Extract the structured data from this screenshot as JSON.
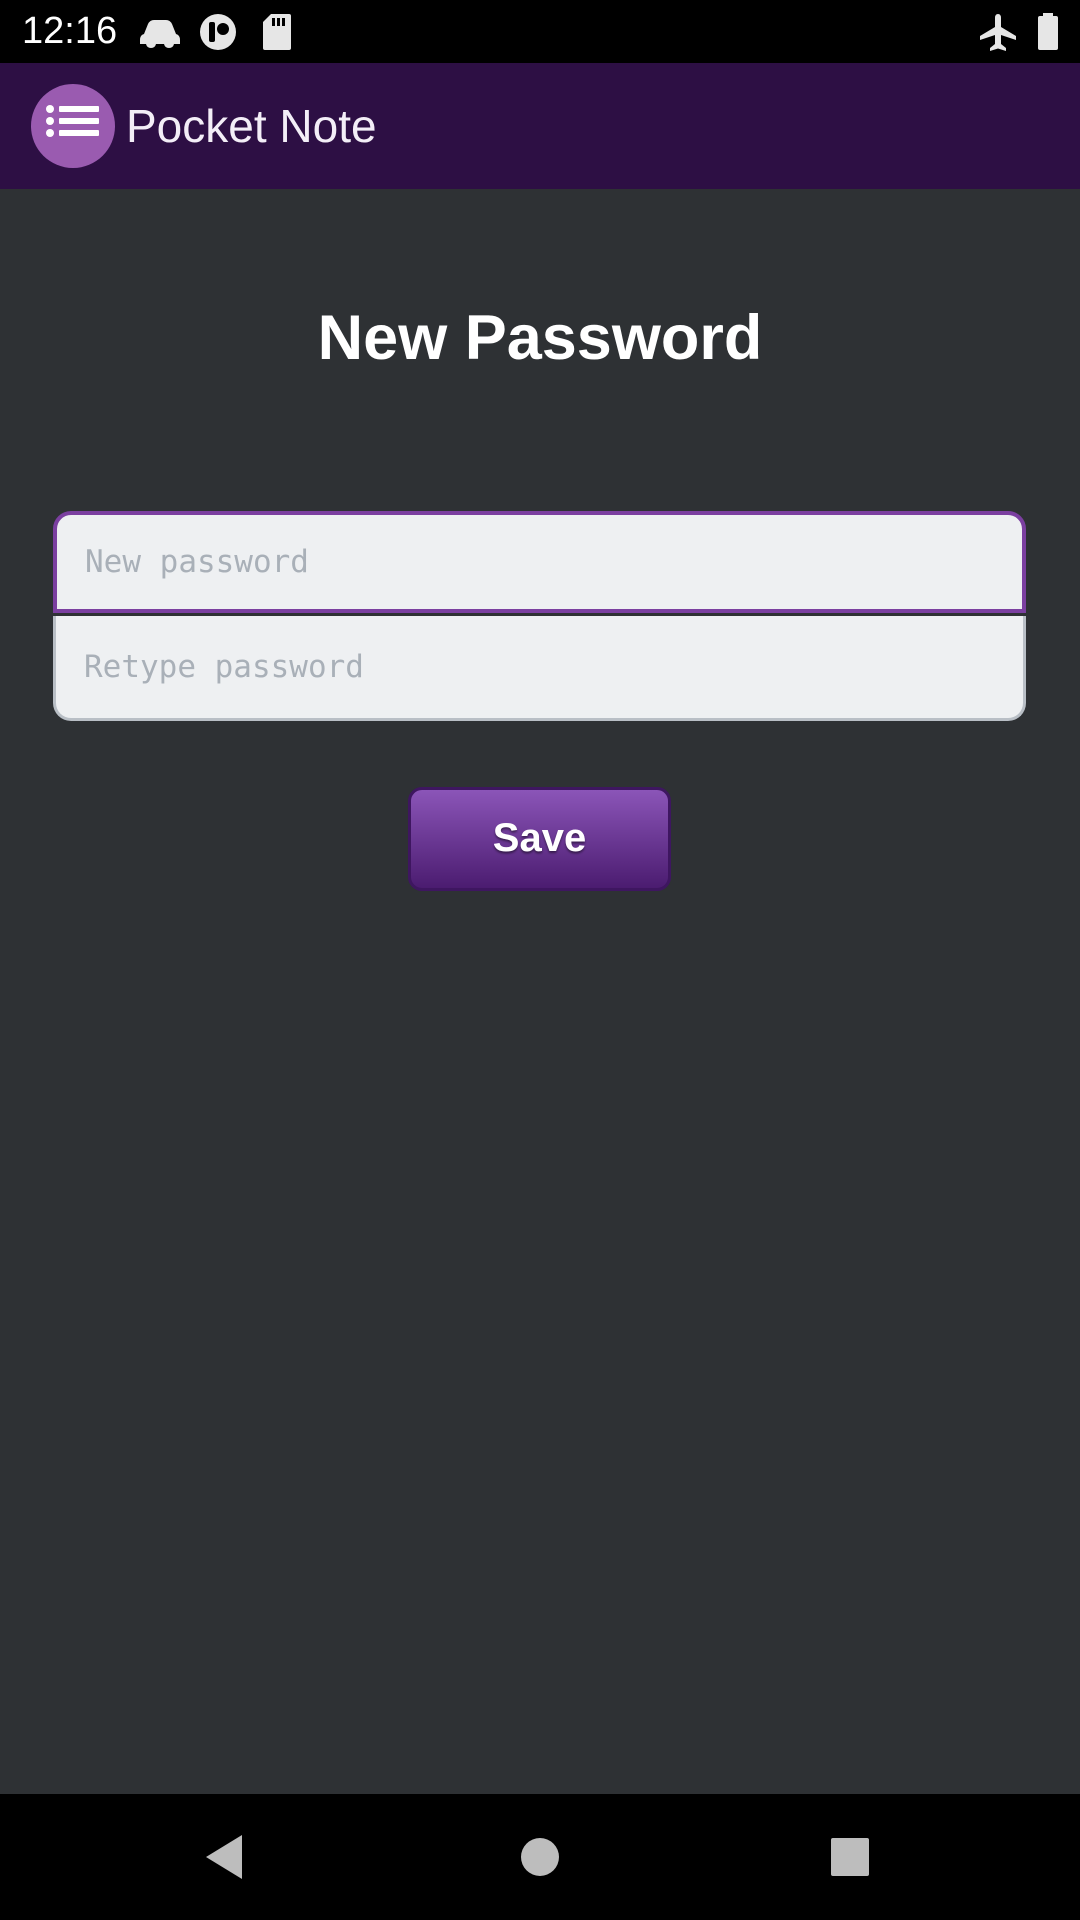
{
  "status_bar": {
    "time": "12:16",
    "icons": [
      "car-icon",
      "vpn-key-icon",
      "sd-card-icon",
      "airplane-mode-icon",
      "battery-icon"
    ]
  },
  "app_bar": {
    "title": "Pocket Note",
    "menu_icon": "list-icon",
    "background": "#2d0f44",
    "accent": "#9a5bb0"
  },
  "page": {
    "title": "New Password",
    "background": "#2e3134"
  },
  "form": {
    "new_password": {
      "value": "",
      "placeholder": "New password"
    },
    "retype_password": {
      "value": "",
      "placeholder": "Retype password"
    },
    "save_label": "Save"
  },
  "nav_bar": {
    "items": [
      "back-icon",
      "home-icon",
      "recents-icon"
    ]
  }
}
